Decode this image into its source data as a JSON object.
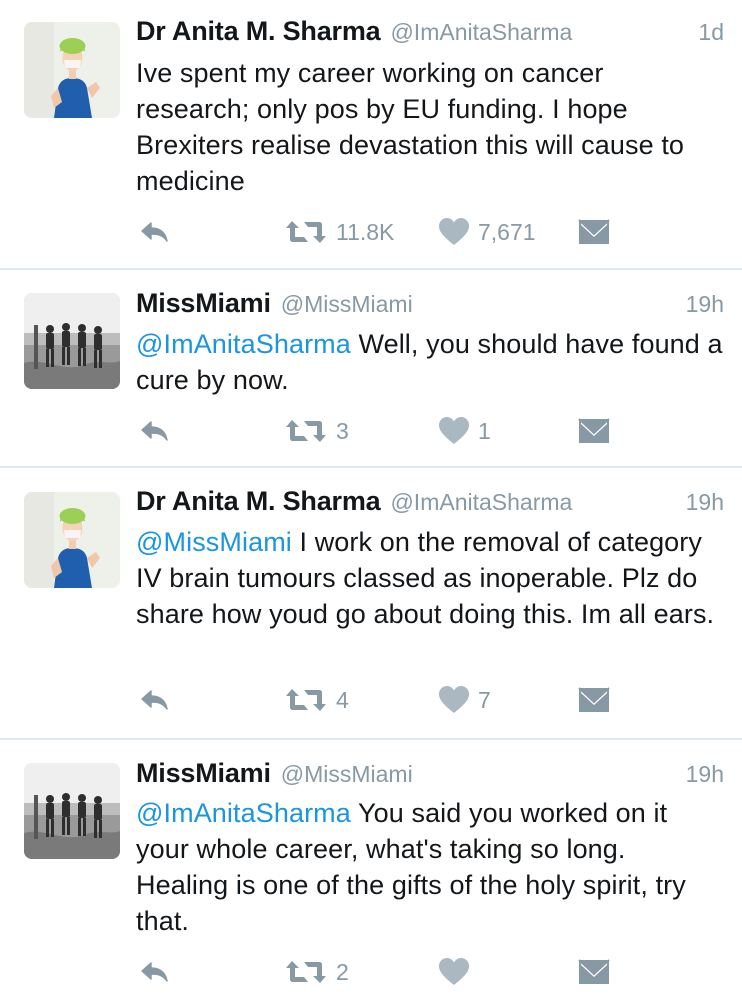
{
  "tweets": [
    {
      "display_name": "Dr Anita M. Sharma",
      "handle": "@ImAnitaSharma",
      "time": "1d",
      "mention": "",
      "text": "Ive spent my career working on cancer research; only pos by EU funding. I hope Brexiters realise devastation this will cause to medicine",
      "retweets": "11.8K",
      "likes": "7,671",
      "avatar": "nurse-avatar"
    },
    {
      "display_name": "MissMiami",
      "handle": "@MissMiami",
      "time": "19h",
      "mention": "@ImAnitaSharma",
      "text": " Well, you should have found a cure by now.",
      "retweets": "3",
      "likes": "1",
      "avatar": "beach-photo-avatar"
    },
    {
      "display_name": "Dr Anita M. Sharma",
      "handle": "@ImAnitaSharma",
      "time": "19h",
      "mention": "@MissMiami",
      "text": " I work on the removal of category IV brain tumours classed as inoperable. Plz do share how youd go about doing this. Im all ears.",
      "retweets": "4",
      "likes": "7",
      "avatar": "nurse-avatar"
    },
    {
      "display_name": "MissMiami",
      "handle": "@MissMiami",
      "time": "19h",
      "mention": "@ImAnitaSharma",
      "text": " You said you worked on it your whole career, what's taking so long. Healing is one of the gifts of the holy spirit, try that.",
      "retweets": "2",
      "likes": "",
      "avatar": "beach-photo-avatar"
    }
  ],
  "colors": {
    "link": "#1b95e0",
    "meta": "#8899a6",
    "divider": "#e1e8ed",
    "text": "#14171a"
  }
}
